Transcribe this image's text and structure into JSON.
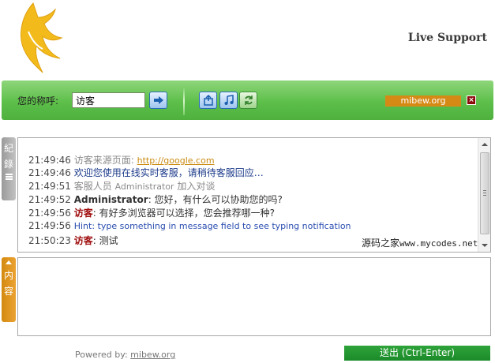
{
  "header": {
    "title": "Live Support"
  },
  "toolbar": {
    "nick_label": "您的称呼:",
    "nick_value": "访客",
    "site_badge": "mibew.org",
    "close_symbol": "×"
  },
  "side_tabs": {
    "history": [
      "紀",
      "錄"
    ],
    "message": [
      "内",
      "容"
    ]
  },
  "chat": {
    "messages": [
      {
        "time": "21:49:46",
        "prefix": "访客来源页面: ",
        "link": "http://google.com"
      },
      {
        "time": "21:49:46",
        "text": "欢迎您使用在线实时客服，请稍待客服回应…"
      },
      {
        "time": "21:49:51",
        "text": "客服人员 ",
        "agent": "Administrator",
        "suffix": " 加入对谈"
      },
      {
        "time": "21:49:52",
        "sender": "Administrator",
        "text": ": 您好，有什么可以协助您的吗?"
      },
      {
        "time": "21:49:56",
        "sender": "访客",
        "text": ": 有好多浏览器可以选择，您会推荐哪一种?"
      },
      {
        "time": "21:49:56",
        "text": "Hint: type something in message field to see typing notification"
      },
      {
        "time": "21:50:23",
        "sender": "访客",
        "text": ": 测试"
      }
    ],
    "watermark_cn": "源码之家",
    "watermark_url": "www.mycodes.net"
  },
  "footer": {
    "powered_by": "Powered by: ",
    "powered_link": "mibew.org",
    "send_label": "送出 (Ctrl-Enter)"
  },
  "colors": {
    "toolbar_green": "#5dbf4a",
    "badge_orange": "#d68a16",
    "send_green": "#1c8a2a",
    "visitor_red": "#a01010"
  }
}
